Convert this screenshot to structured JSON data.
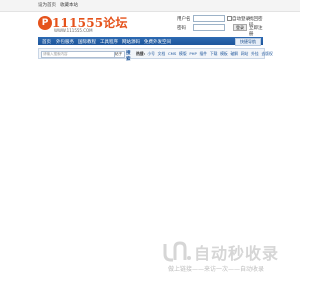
{
  "topbar": {
    "set_home": "设为首页",
    "favorite": "收藏本站"
  },
  "logo": {
    "text": "111555论坛",
    "url": "WWW.111555.COM"
  },
  "login": {
    "username_label": "用户名",
    "password_label": "密码",
    "auto_login": "自动登录",
    "forgot_password": "找回密码",
    "login_button": "登录",
    "register_link": "立即注册"
  },
  "nav": {
    "items": [
      "首页",
      "外包服务",
      "国际教程",
      "工具程序",
      "网站源码",
      "免费外发空间"
    ],
    "quick": "快捷导航"
  },
  "search": {
    "placeholder": "请输入搜索内容",
    "type": "帖子",
    "button": "搜索",
    "hot_label": "热搜:",
    "hot": [
      "小号",
      "文档",
      "CMS",
      "模版",
      "PHP",
      "插件",
      "下载",
      "模板",
      "破解",
      "网站",
      "外挂",
      "去版权"
    ]
  },
  "watermark": {
    "title": "自动秒收录",
    "subtitle": "做上链接——来访一次——自动收录"
  },
  "colors": {
    "nav_bg": "#1d559b",
    "logo": "#e5521b",
    "watermark": "#d6d6d6"
  }
}
